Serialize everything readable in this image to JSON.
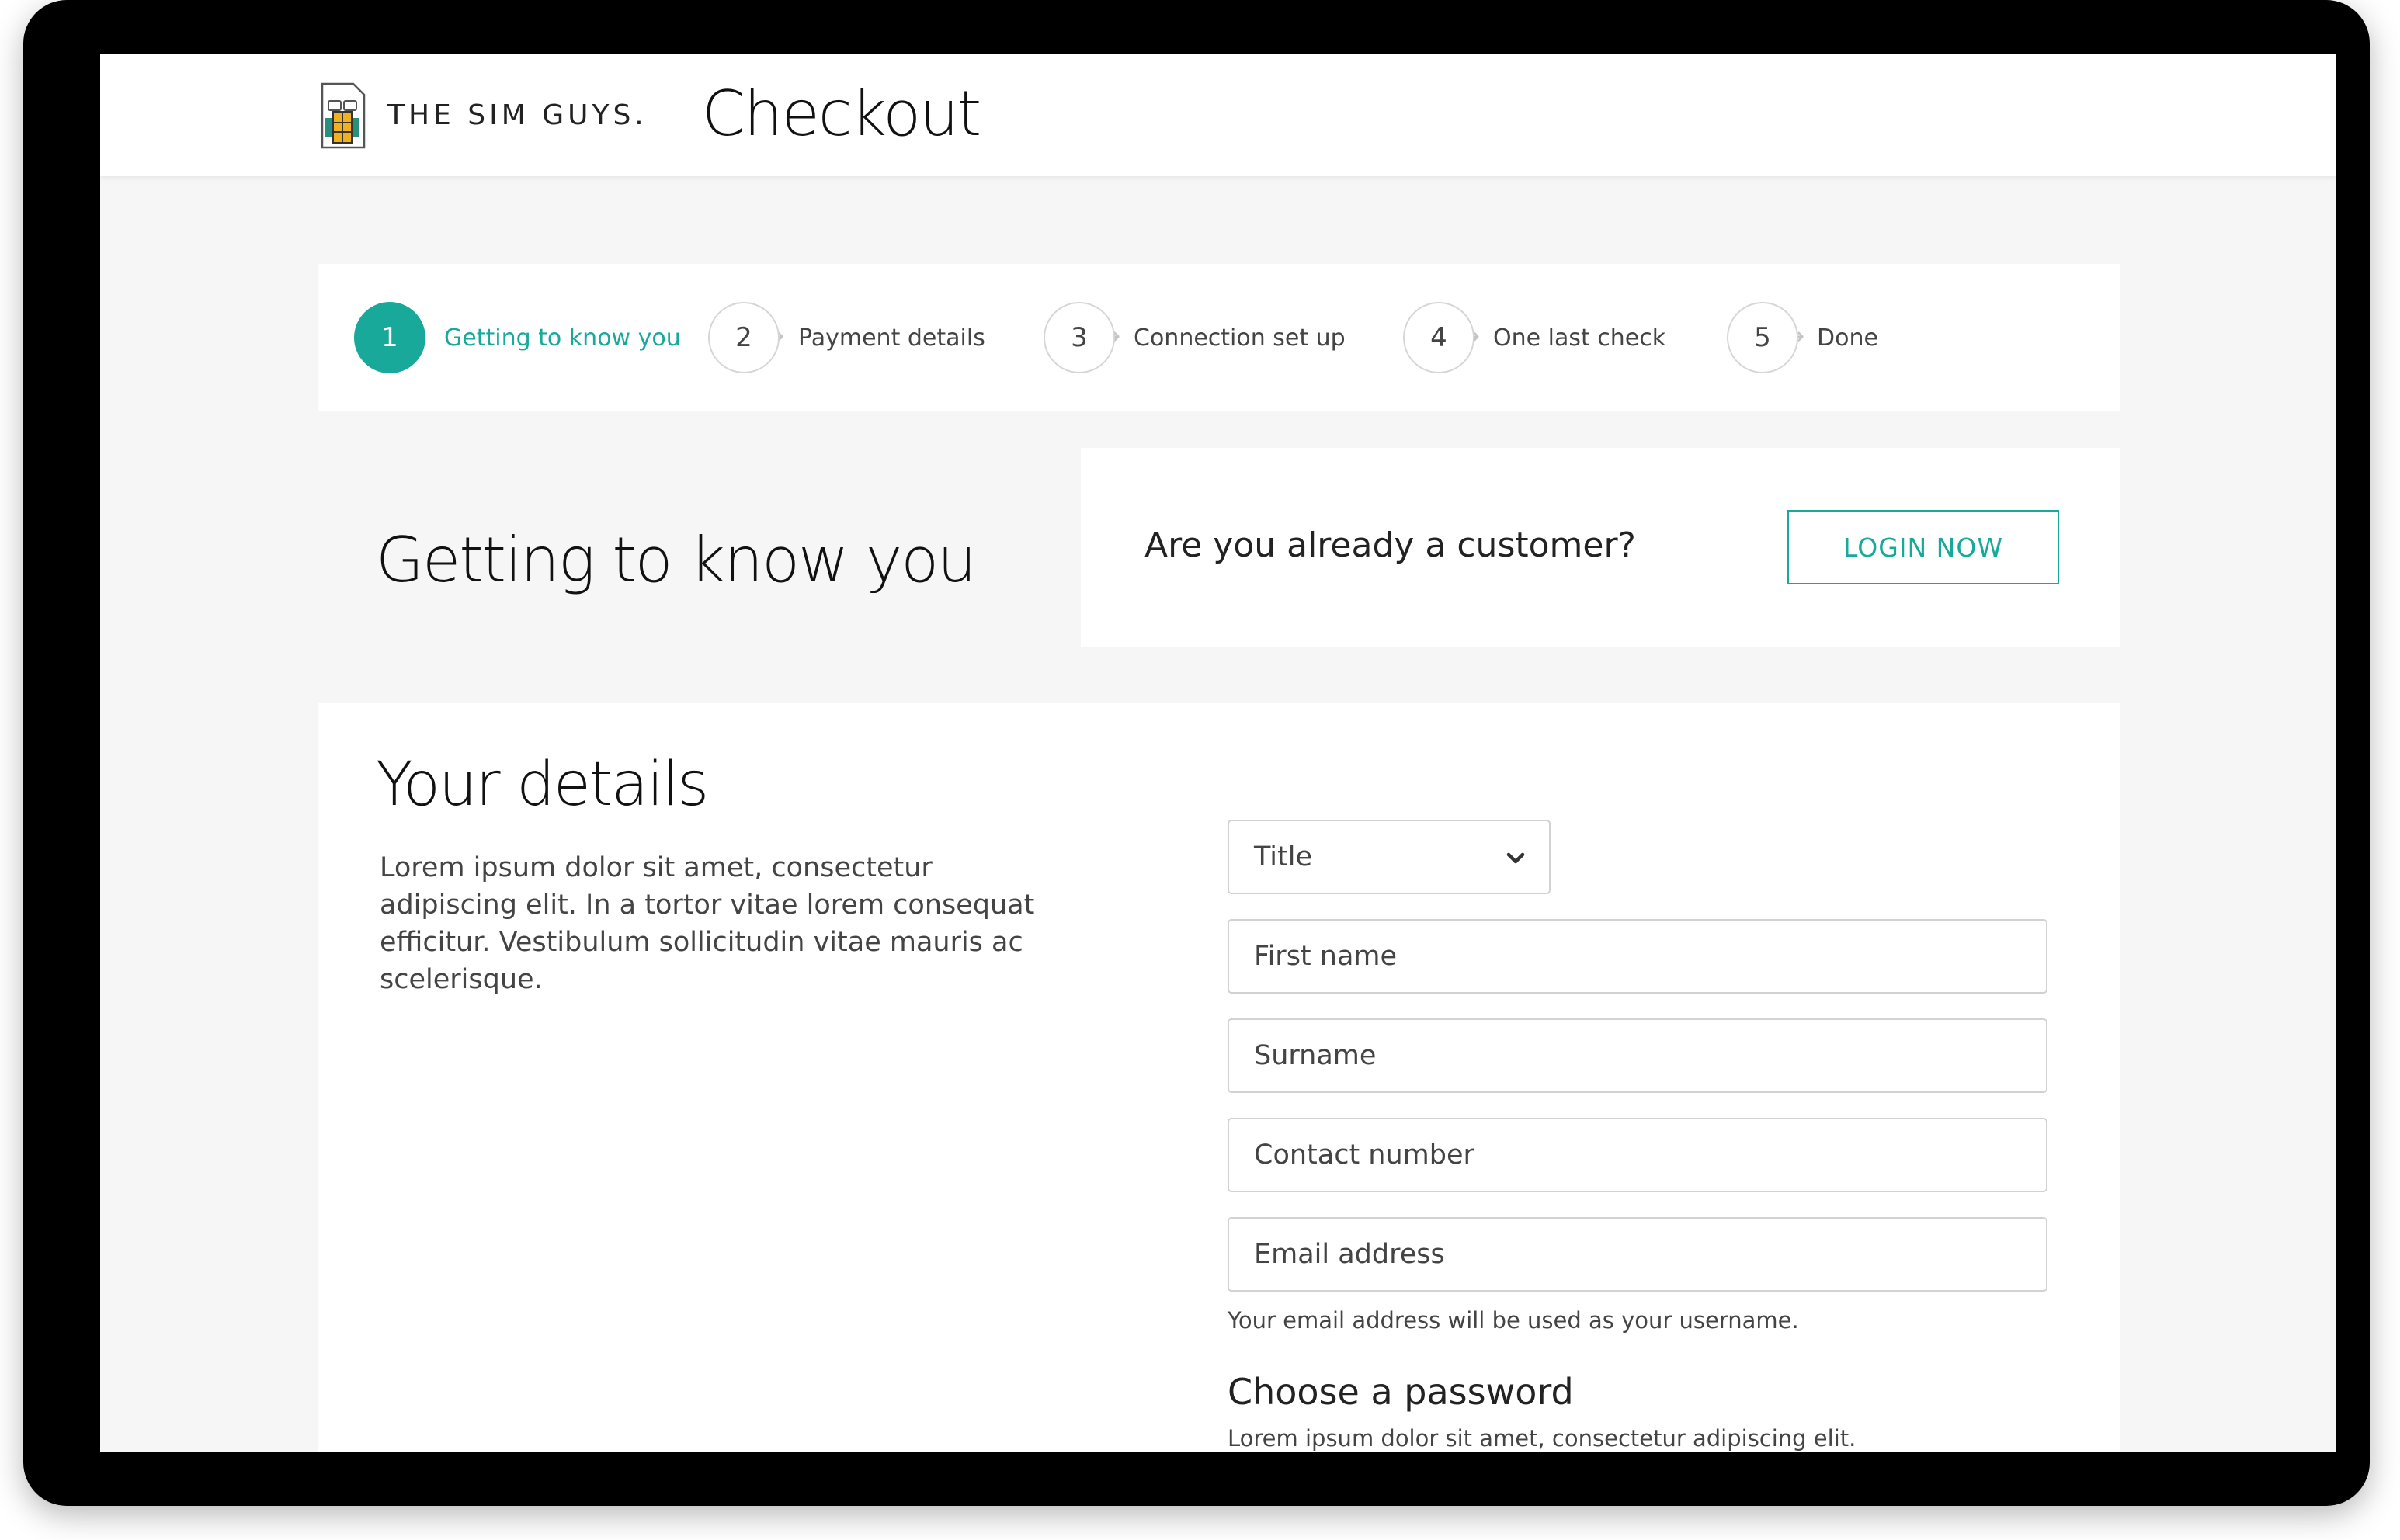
{
  "header": {
    "brand": "THE SIM GUYS.",
    "page_title": "Checkout"
  },
  "stepper": {
    "steps": [
      {
        "number": "1",
        "label": "Getting to know you",
        "active": true
      },
      {
        "number": "2",
        "label": "Payment details",
        "active": false
      },
      {
        "number": "3",
        "label": "Connection set up",
        "active": false
      },
      {
        "number": "4",
        "label": "One last check",
        "active": false
      },
      {
        "number": "5",
        "label": "Done",
        "active": false
      }
    ],
    "arrow_icon": "arrow-right-icon"
  },
  "intro": {
    "title": "Getting to know you",
    "customer_question": "Are you already a customer?",
    "login_label": "LOGIN NOW"
  },
  "details": {
    "title": "Your details",
    "description": "Lorem ipsum dolor sit amet, consectetur adipiscing elit. In a tortor vitae lorem consequat efficitur. Vestibulum sollicitudin vitae mauris ac scelerisque.",
    "title_select": {
      "value": "Title",
      "icon": "chevron-down-icon"
    },
    "fields": {
      "first_name": "First name",
      "surname": "Surname",
      "contact_number": "Contact number",
      "email": "Email address"
    },
    "email_help": "Your email address will be used as your username.",
    "password_heading": "Choose a password",
    "password_help": "Lorem ipsum dolor sit amet, consectetur adipiscing elit."
  },
  "colors": {
    "accent": "#18a99b",
    "page_background": "#f6f6f6",
    "device_frame": "#000000"
  }
}
